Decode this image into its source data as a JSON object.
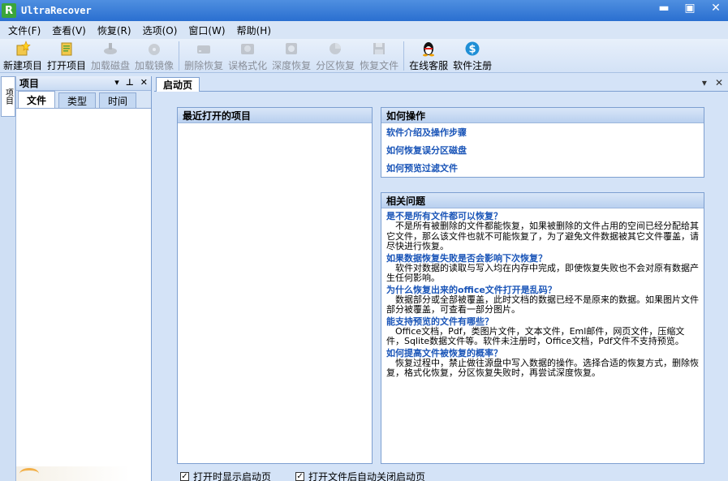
{
  "app": {
    "logo_letter": "R",
    "title": "UltraRecover",
    "window_buttons": [
      "▬",
      "▣",
      "✕"
    ]
  },
  "menubar": [
    {
      "label": "文件(F)"
    },
    {
      "label": "查看(V)"
    },
    {
      "label": "恢复(R)"
    },
    {
      "label": "选项(O)"
    },
    {
      "label": "窗口(W)"
    },
    {
      "label": "帮助(H)"
    }
  ],
  "toolbar": {
    "new_project": "新建项目",
    "open_project": "打开项目",
    "load_disk": "加载磁盘",
    "load_image": "加载镜像",
    "delete_recover": "删除恢复",
    "format_recover": "误格式化",
    "deep_recover": "深度恢复",
    "partition_recover": "分区恢复",
    "file_recover": "恢复文件",
    "online_service": "在线客服",
    "register": "软件注册"
  },
  "side_strip": {
    "tab_label": "项目"
  },
  "left_panel": {
    "title": "项目",
    "ctrl_dropdown": "▾",
    "ctrl_pin": "⊥",
    "ctrl_close": "✕",
    "tabs": [
      "文件",
      "类型",
      "时间"
    ]
  },
  "main": {
    "tab_label": "启动页",
    "ctrl_dropdown": "▾",
    "ctrl_close": "✕",
    "recent_title": "最近打开的项目",
    "howto_title": "如何操作",
    "howto_links": [
      "软件介绍及操作步骤",
      "如何恢复误分区磁盘",
      "如何预览过滤文件"
    ],
    "faq_title": "相关问题",
    "faq": [
      {
        "q": "是不是所有文件都可以恢复？",
        "a": "　不是所有被删除的文件都能恢复，如果被删除的文件占用的空间已经分配给其它文件，那么该文件也就不可能恢复了，为了避免文件数据被其它文件覆盖，请尽快进行恢复。"
      },
      {
        "q": "如果数据恢复失败是否会影响下次恢复？",
        "a": "　软件对数据的读取与写入均在内存中完成，即使恢复失败也不会对原有数据产生任何影响。"
      },
      {
        "q": "为什么恢复出来的office文件打开是乱码？",
        "a": "　数据部分或全部被覆盖，此时文档的数据已经不是原来的数据。如果图片文件部分被覆盖，可查看一部分图片。"
      },
      {
        "q": "能支持预览的文件有哪些？",
        "a": "　Office文档，Pdf，类图片文件，文本文件，Eml邮件，网页文件，压缩文件，Sqlite数据文件等。软件未注册时，Office文档，Pdf文件不支持预览。"
      },
      {
        "q": "如何提高文件被恢复的概率？",
        "a": "　恢复过程中，禁止做往源盘中写入数据的操作。选择合适的恢复方式，删除恢复，格式化恢复，分区恢复失败时，再尝试深度恢复。"
      }
    ],
    "check_show_on_open": "打开时显示启动页",
    "check_close_after_open": "打开文件后自动关闭启动页",
    "check_mark": "✓"
  },
  "colors": {
    "titlebar": "#2a6fd0",
    "link": "#1a55b8",
    "panel_border": "#7d9fd0"
  }
}
